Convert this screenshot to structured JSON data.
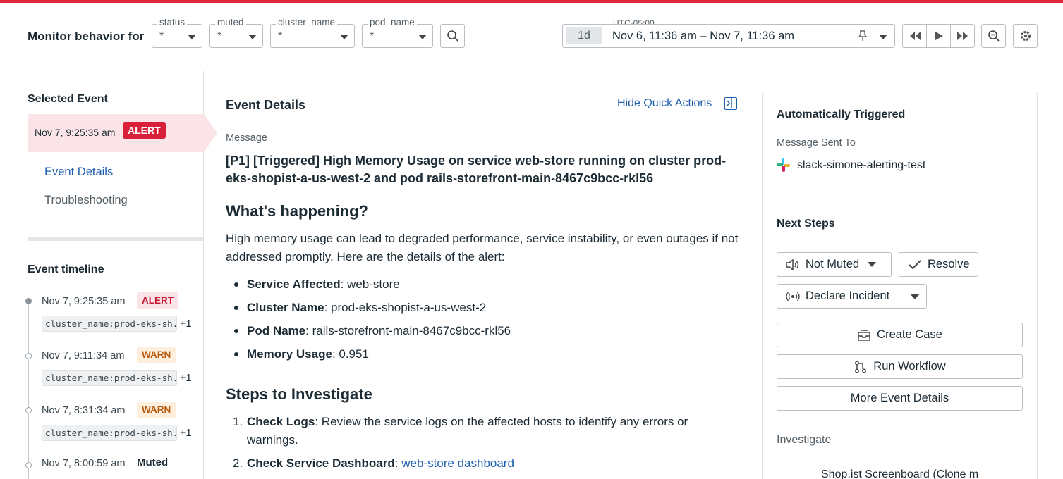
{
  "header": {
    "title": "Monitor behavior for",
    "filters": [
      {
        "label": "status",
        "value": "*"
      },
      {
        "label": "muted",
        "value": "*"
      },
      {
        "label": "cluster_name",
        "value": "*"
      },
      {
        "label": "pod_name",
        "value": "*"
      }
    ],
    "timezone": "UTC-05:00",
    "range_pill": "1d",
    "range_text": "Nov 6, 11:36 am – Nov 7, 11:36 am",
    "icons": {
      "search": "search-icon",
      "pin": "pin-icon",
      "rewind": "rewind-icon",
      "play": "play-icon",
      "forward": "fast-forward-icon",
      "zoom_out": "zoom-out-icon",
      "settings": "gear-icon"
    }
  },
  "left": {
    "selected_title": "Selected Event",
    "selected": {
      "time": "Nov 7, 9:25:35 am",
      "badge": "ALERT"
    },
    "nav": [
      "Event Details",
      "Troubleshooting"
    ],
    "timeline_title": "Event timeline",
    "timeline": [
      {
        "time": "Nov 7, 9:25:35 am",
        "badge": "ALERT",
        "tag": "cluster_name:prod-eks-sh...",
        "plus": "+1"
      },
      {
        "time": "Nov 7, 9:11:34 am",
        "badge": "WARN",
        "tag": "cluster_name:prod-eks-sh...",
        "plus": "+1"
      },
      {
        "time": "Nov 7, 8:31:34 am",
        "badge": "WARN",
        "tag": "cluster_name:prod-eks-sh...",
        "plus": "+1"
      },
      {
        "time": "Nov 7, 8:00:59 am",
        "badge": "Muted"
      }
    ]
  },
  "main": {
    "title": "Event Details",
    "hide_quick_actions": "Hide Quick Actions",
    "message_label": "Message",
    "message": "[P1] [Triggered] High Memory Usage on service web-store running on cluster prod-eks-shopist-a-us-west-2 and pod rails-storefront-main-8467c9bcc-rkl56",
    "h1": "What's happening?",
    "intro": "High memory usage can lead to degraded performance, service instability, or even outages if not addressed promptly. Here are the details of the alert:",
    "details": [
      {
        "key": "Service Affected",
        "value": ": web-store"
      },
      {
        "key": "Cluster Name",
        "value": ": prod-eks-shopist-a-us-west-2"
      },
      {
        "key": "Pod Name",
        "value": ": rails-storefront-main-8467c9bcc-rkl56"
      },
      {
        "key": "Memory Usage",
        "value": ": 0.951"
      }
    ],
    "h2": "Steps to Investigate",
    "steps": [
      {
        "num": "1.",
        "key": "Check Logs",
        "value": ": Review the service logs on the affected hosts to identify any errors or warnings."
      },
      {
        "num": "2.",
        "key": "Check Service Dashboard",
        "value": ": ",
        "link": "web-store dashboard"
      }
    ]
  },
  "right": {
    "title": "Automatically Triggered",
    "sent_label": "Message Sent To",
    "channel": "slack-simone-alerting-test",
    "next_title": "Next Steps",
    "not_muted": "Not Muted",
    "resolve": "Resolve",
    "declare": "Declare Incident",
    "create_case": "Create Case",
    "run_workflow": "Run Workflow",
    "more_details": "More Event Details",
    "investigate": "Investigate",
    "screenboard": "Shop.ist Screenboard (Clone m"
  }
}
